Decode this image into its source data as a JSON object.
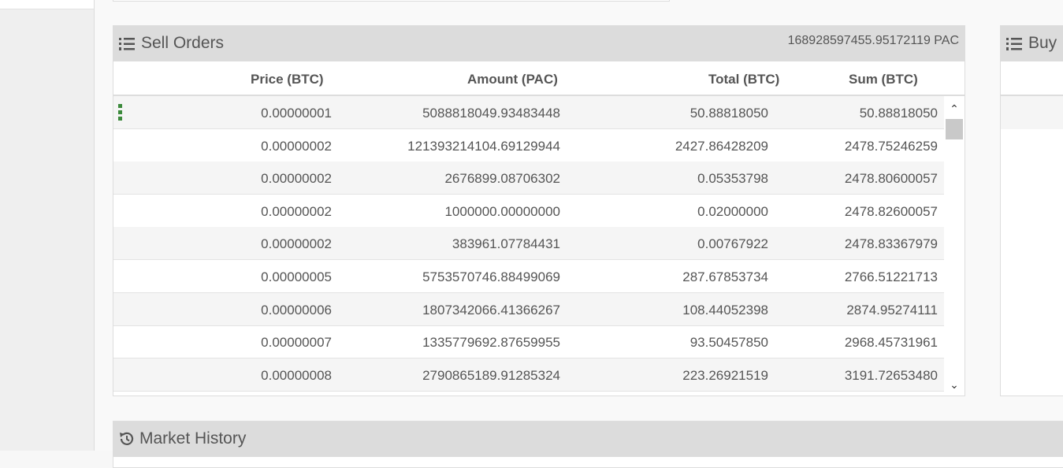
{
  "sell_orders": {
    "title": "Sell Orders",
    "total_amount": "168928597455.95172119 PAC",
    "columns": {
      "price": "Price (BTC)",
      "amount": "Amount (PAC)",
      "total": "Total (BTC)",
      "sum": "Sum (BTC)"
    },
    "rows": [
      {
        "price": "0.00000001",
        "amount": "5088818049.93483448",
        "total": "50.88818050",
        "sum": "50.88818050"
      },
      {
        "price": "0.00000002",
        "amount": "121393214104.69129944",
        "total": "2427.86428209",
        "sum": "2478.75246259"
      },
      {
        "price": "0.00000002",
        "amount": "2676899.08706302",
        "total": "0.05353798",
        "sum": "2478.80600057"
      },
      {
        "price": "0.00000002",
        "amount": "1000000.00000000",
        "total": "0.02000000",
        "sum": "2478.82600057"
      },
      {
        "price": "0.00000002",
        "amount": "383961.07784431",
        "total": "0.00767922",
        "sum": "2478.83367979"
      },
      {
        "price": "0.00000005",
        "amount": "5753570746.88499069",
        "total": "287.67853734",
        "sum": "2766.51221713"
      },
      {
        "price": "0.00000006",
        "amount": "1807342066.41366267",
        "total": "108.44052398",
        "sum": "2874.95274111"
      },
      {
        "price": "0.00000007",
        "amount": "1335779692.87659955",
        "total": "93.50457850",
        "sum": "2968.45731961"
      },
      {
        "price": "0.00000008",
        "amount": "2790865189.91285324",
        "total": "223.26921519",
        "sum": "3191.72653480"
      }
    ]
  },
  "buy_orders": {
    "title": "Buy"
  },
  "market_history": {
    "title": "Market History"
  },
  "icons": {
    "list": "list-ordered-icon",
    "history": "history-icon",
    "drag": "drag-handle-icon",
    "up": "chevron-up-icon",
    "down": "chevron-down-icon"
  },
  "colors": {
    "panel_heading": "#dcdcdc",
    "stripe": "#f5f5f5",
    "drag_handle": "#3c8a3c"
  }
}
